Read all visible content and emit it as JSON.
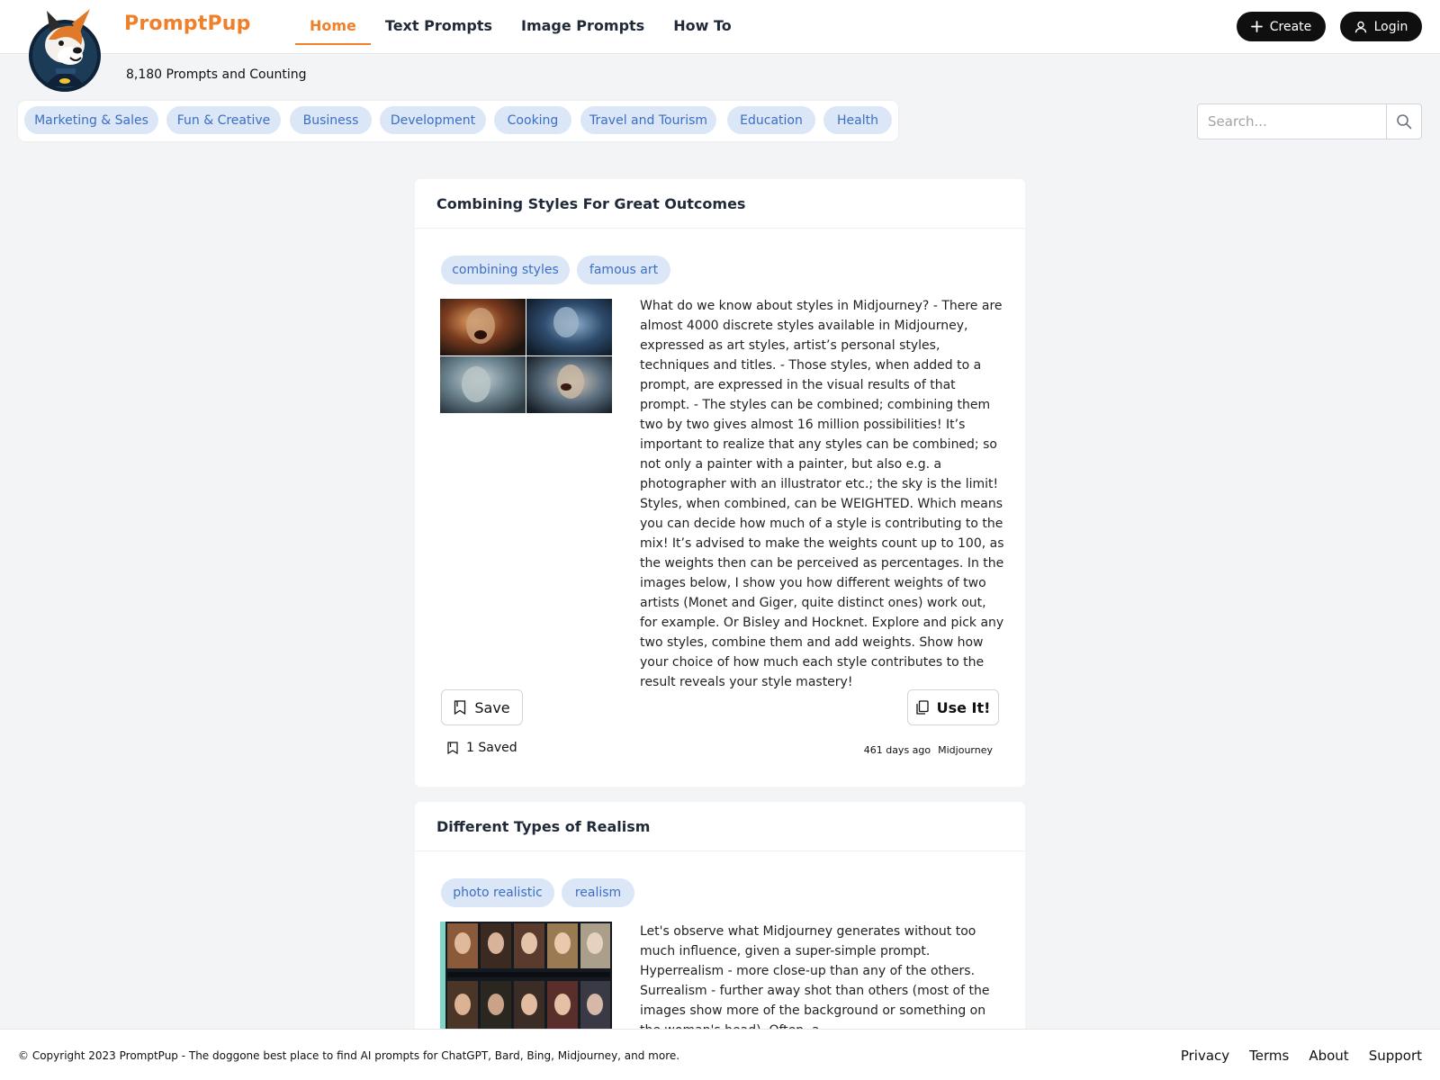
{
  "header": {
    "brand": "PromptPup",
    "nav": [
      "Home",
      "Text Prompts",
      "Image Prompts",
      "How To"
    ],
    "create_label": "Create",
    "login_label": "Login"
  },
  "counter": "8,180 Prompts and Counting",
  "categories": [
    "Marketing & Sales",
    "Fun & Creative",
    "Business",
    "Development",
    "Cooking",
    "Travel and Tourism",
    "Education",
    "Health"
  ],
  "search": {
    "placeholder": "Search..."
  },
  "cards": [
    {
      "title": "Combining Styles For Great Outcomes",
      "tags": [
        "combining styles",
        "famous art"
      ],
      "description": "What do we know about styles in Midjourney? - There are almost 4000 discrete styles available in Midjourney, expressed as art styles, artist’s personal styles, techniques and titles. - Those styles, when added to a prompt, are expressed in the visual results of that prompt. - The styles can be combined; combining them two by two gives almost 16 million possibilities! It’s important to realize that any styles can be combined; so not only a painter with a painter, but also e.g. a photographer with an illustrator etc.; the sky is the limit! Styles, when combined, can be WEIGHTED. Which means you can decide how much of a style is contributing to the mix! It’s advised to make the weights count up to 100, as the weights then can be perceived as percentages. In the images below, I show you how different weights of two artists (Monet and Giger, quite distinct ones) work out, for example. Or Bisley and Hocknet. Explore and pick any two styles, combine them and add weights. Show how your choice of how much each style contributes to the result reveals your style mastery!",
      "save_label": "Save",
      "use_label": "Use It!",
      "saved_text": "1 Saved",
      "age": "461 days ago",
      "model": "Midjourney"
    },
    {
      "title": "Different Types of Realism",
      "tags": [
        "photo realistic",
        "realism"
      ],
      "description": "Let's observe what Midjourney generates without too much influence, given a super-simple prompt. Hyperrealism - more close-up than any of the others. Surrealism - further away shot than others (most of the images show more of the background or something on the woman's head). Often, a"
    }
  ],
  "footer": {
    "copyright": "© Copyright 2023 PromptPup - The doggone best place to find AI prompts for ChatGPT, Bard, Bing, Midjourney, and more.",
    "links": [
      "Privacy",
      "Terms",
      "About",
      "Support"
    ]
  },
  "colors": {
    "accent": "#f07f2a",
    "chip_bg": "#dbe6f7",
    "chip_text": "#3b6fc4",
    "dark_button": "#0f0f0f"
  }
}
